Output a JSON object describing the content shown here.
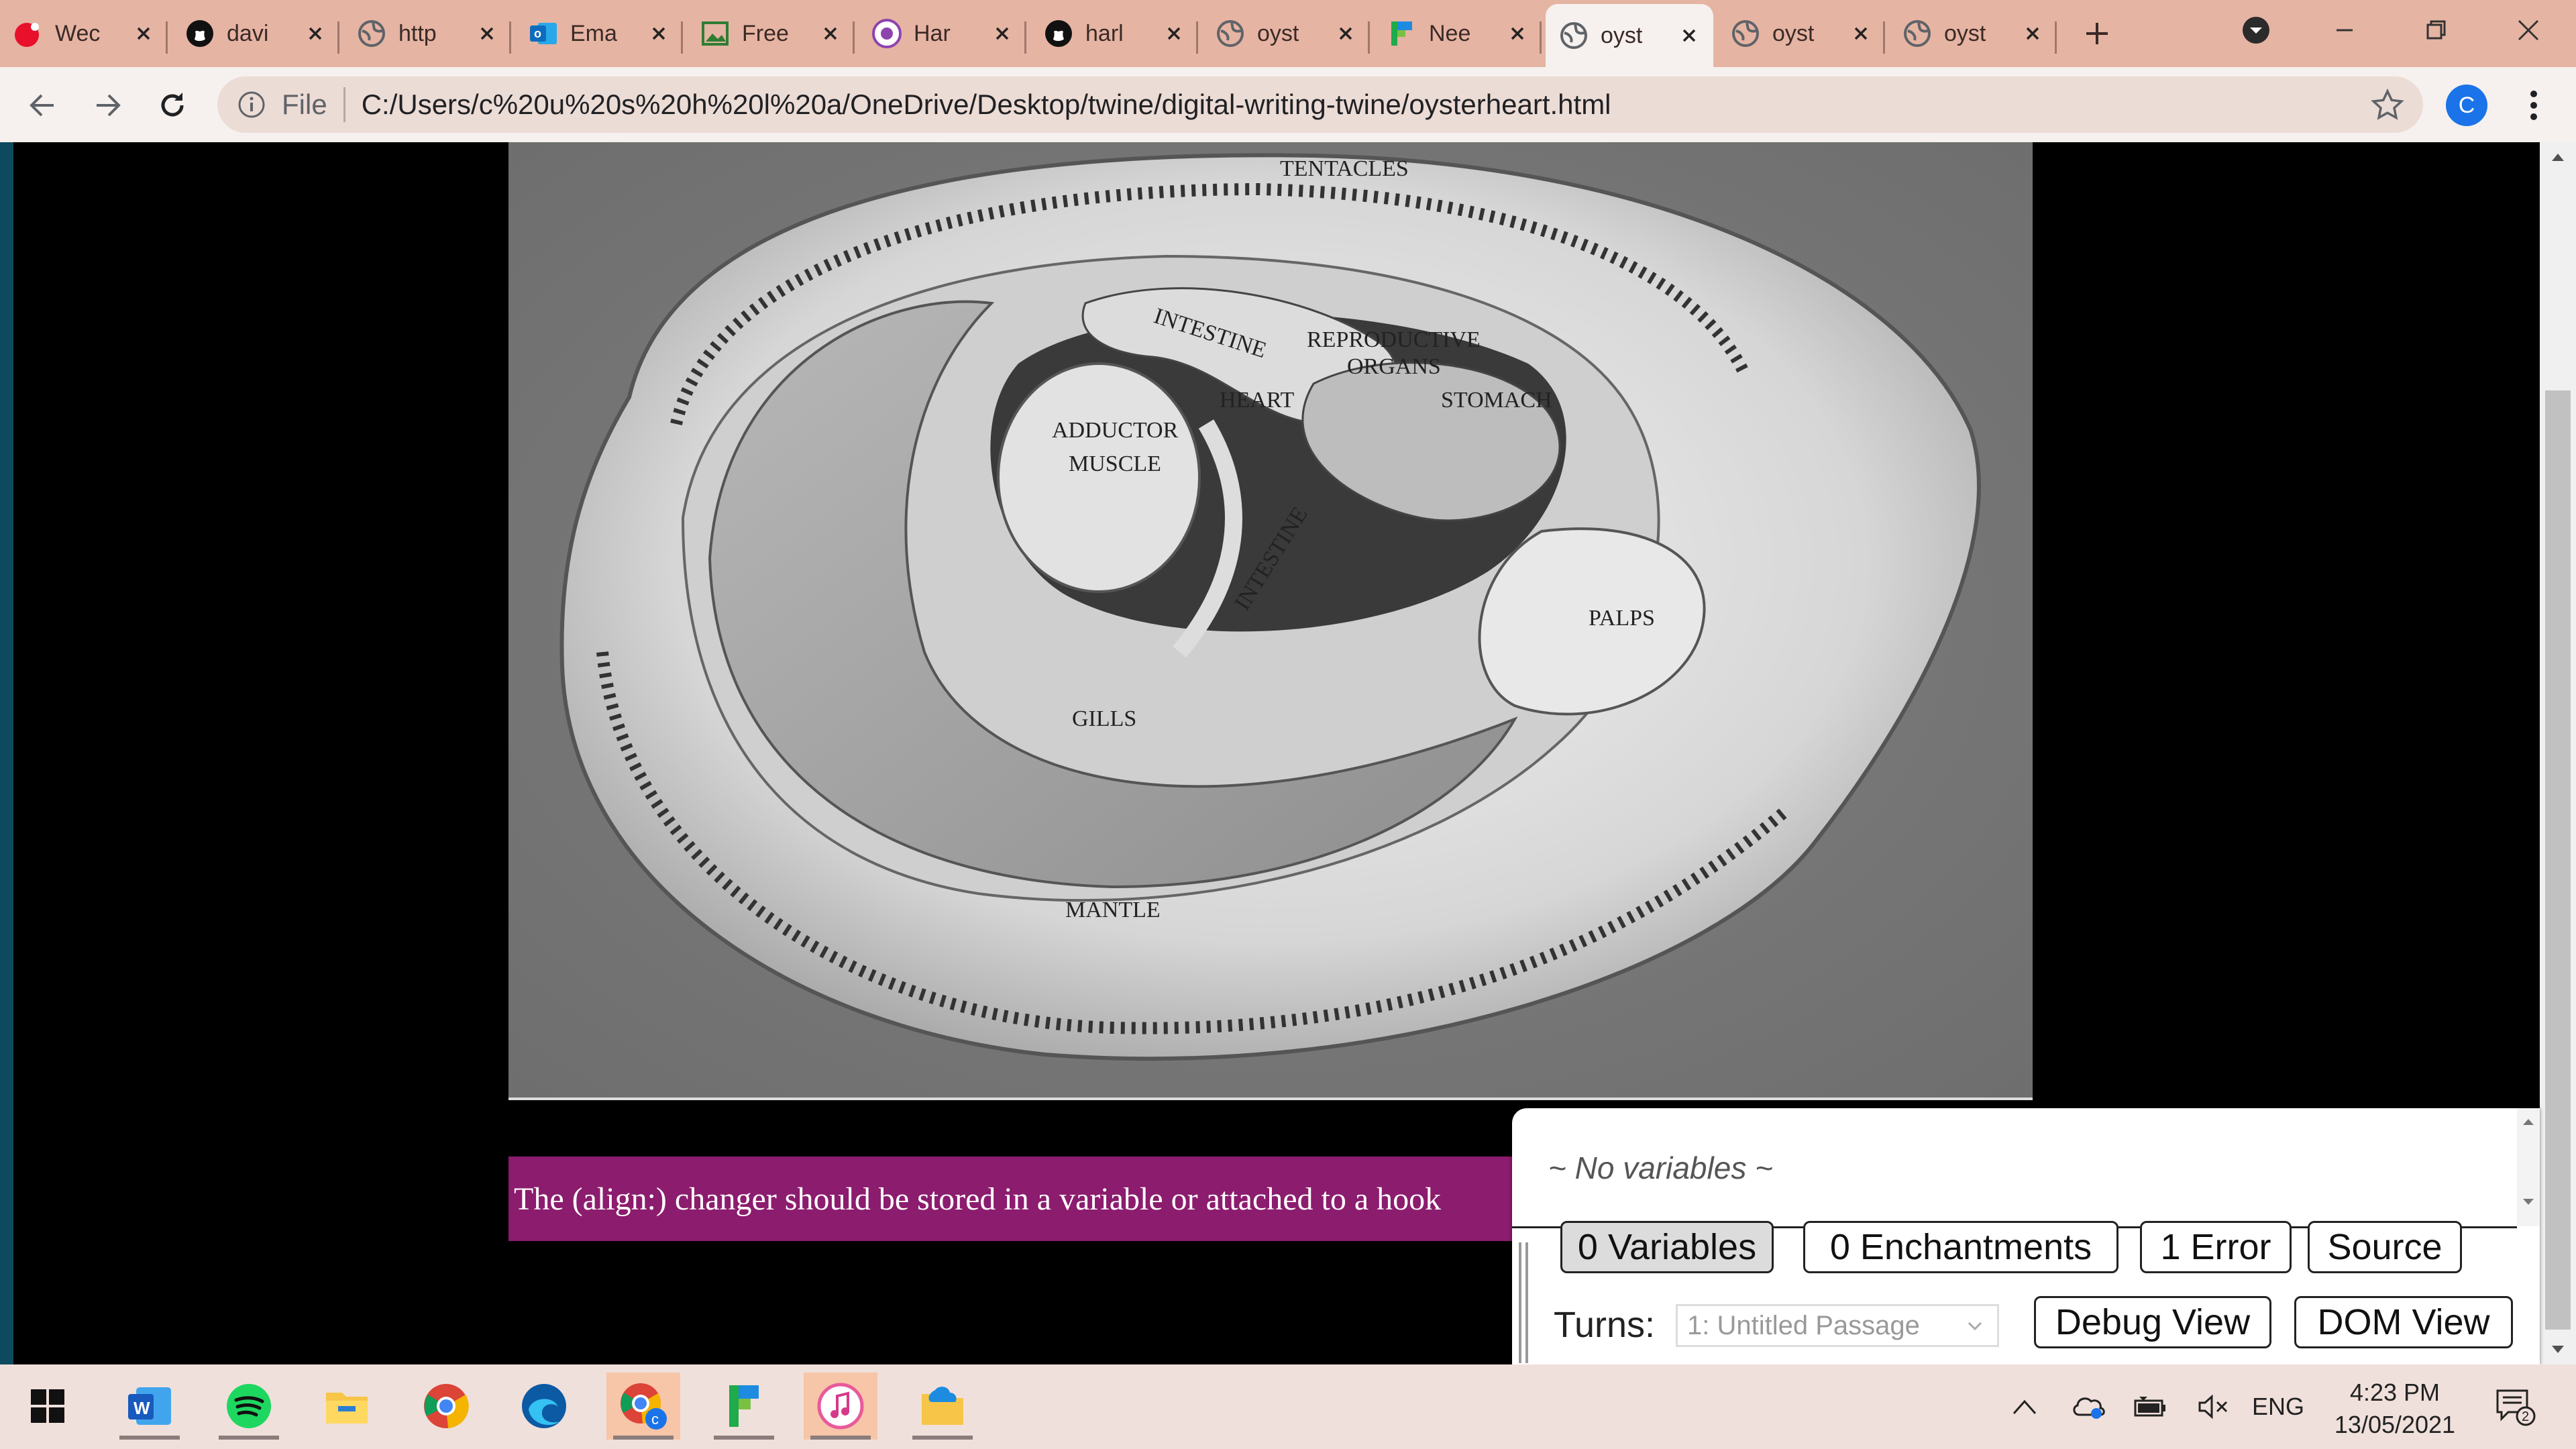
{
  "browser": {
    "tabs": [
      {
        "title": "Wec",
        "icon": "red-circle-icon",
        "color": "#e8102a"
      },
      {
        "title": "davi",
        "icon": "github-icon",
        "color": "#111111"
      },
      {
        "title": "http",
        "icon": "globe-icon",
        "color": "#5f6368"
      },
      {
        "title": "Ema",
        "icon": "outlook-icon",
        "color": "#0f6cbd"
      },
      {
        "title": "Free",
        "icon": "image-icon",
        "color": "#2e7d32"
      },
      {
        "title": "Har",
        "icon": "purple-swirl-icon",
        "color": "#8e44ad"
      },
      {
        "title": "harl",
        "icon": "github-icon",
        "color": "#111111"
      },
      {
        "title": "oyst",
        "icon": "globe-icon",
        "color": "#5f6368"
      },
      {
        "title": "Nee",
        "icon": "flag-icon",
        "color": "#1faa4b"
      },
      {
        "title": "oyst",
        "icon": "globe-icon",
        "color": "#5f6368",
        "active": true
      },
      {
        "title": "oyst",
        "icon": "globe-icon",
        "color": "#5f6368"
      },
      {
        "title": "oyst",
        "icon": "globe-icon",
        "color": "#5f6368"
      }
    ],
    "address": {
      "scheme": "File",
      "url": "C:/Users/c%20u%20s%20h%20l%20a/OneDrive/Desktop/twine/digital-writing-twine/oysterheart.html"
    },
    "profile_initial": "C"
  },
  "page": {
    "image_labels": {
      "tentacles": "TENTACLES",
      "intestine_top": "INTESTINE",
      "reproductive": "REPRODUCTIVE",
      "organs": "ORGANS",
      "heart": "HEART",
      "stomach": "STOMACH",
      "adductor": "ADDUCTOR",
      "muscle": "MUSCLE",
      "intestine_bottom": "INTESTINE",
      "palps": "PALPS",
      "gills": "GILLS",
      "mantle": "MANTLE"
    },
    "error_message": "The (align:) changer should be stored in a variable or attached to a hook"
  },
  "debug_panel": {
    "no_variables": "~ No variables ~",
    "buttons": {
      "variables": "0 Variables",
      "enchantments": "0 Enchantments",
      "errors": "1 Error",
      "source": "Source",
      "debug_view": "Debug View",
      "dom_view": "DOM View"
    },
    "turns_label": "Turns:",
    "turns_value": "1: Untitled Passage"
  },
  "taskbar": {
    "apps": [
      "windows-start-icon",
      "word-icon",
      "spotify-icon",
      "file-explorer-icon",
      "chrome-icon",
      "edge-icon",
      "chrome-profile-icon",
      "twine-icon",
      "itunes-icon",
      "onedrive-folder-icon"
    ],
    "language": "ENG",
    "time": "4:23 PM",
    "date": "13/05/2021",
    "notifications": "2"
  }
}
